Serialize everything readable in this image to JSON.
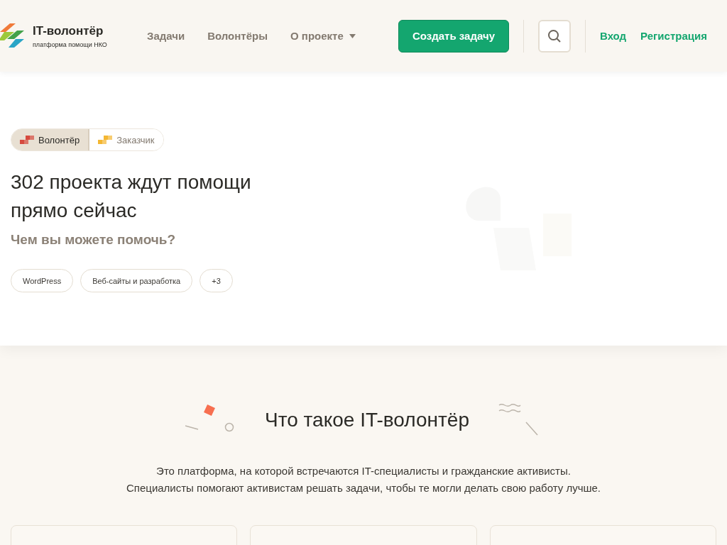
{
  "header": {
    "logo": {
      "title": "IT-волонтёр",
      "subtitle": "платформа помощи НКО"
    },
    "nav": [
      {
        "label": "Задачи",
        "dropdown": false
      },
      {
        "label": "Волонтёры",
        "dropdown": false
      },
      {
        "label": "О проекте",
        "dropdown": true
      }
    ],
    "create_button": "Создать задачу",
    "login": "Вход",
    "register": "Регистрация"
  },
  "hero": {
    "roles": [
      {
        "label": "Волонтёр",
        "selected": true
      },
      {
        "label": "Заказчик",
        "selected": false
      }
    ],
    "title": "302 проекта ждут помощи прямо сейчас",
    "subtitle": "Чем вы можете помочь?",
    "tags": [
      "WordPress",
      "Веб-сайты и разработка",
      "+3"
    ]
  },
  "about": {
    "title": "Что такое IT-волонтёр",
    "lines": [
      "Это платформа, на которой встречаются IT-специалисты и гражданские активисты.",
      "Специалисты помогают активистам решать задачи, чтобы те могли делать свою работу лучше."
    ]
  }
}
